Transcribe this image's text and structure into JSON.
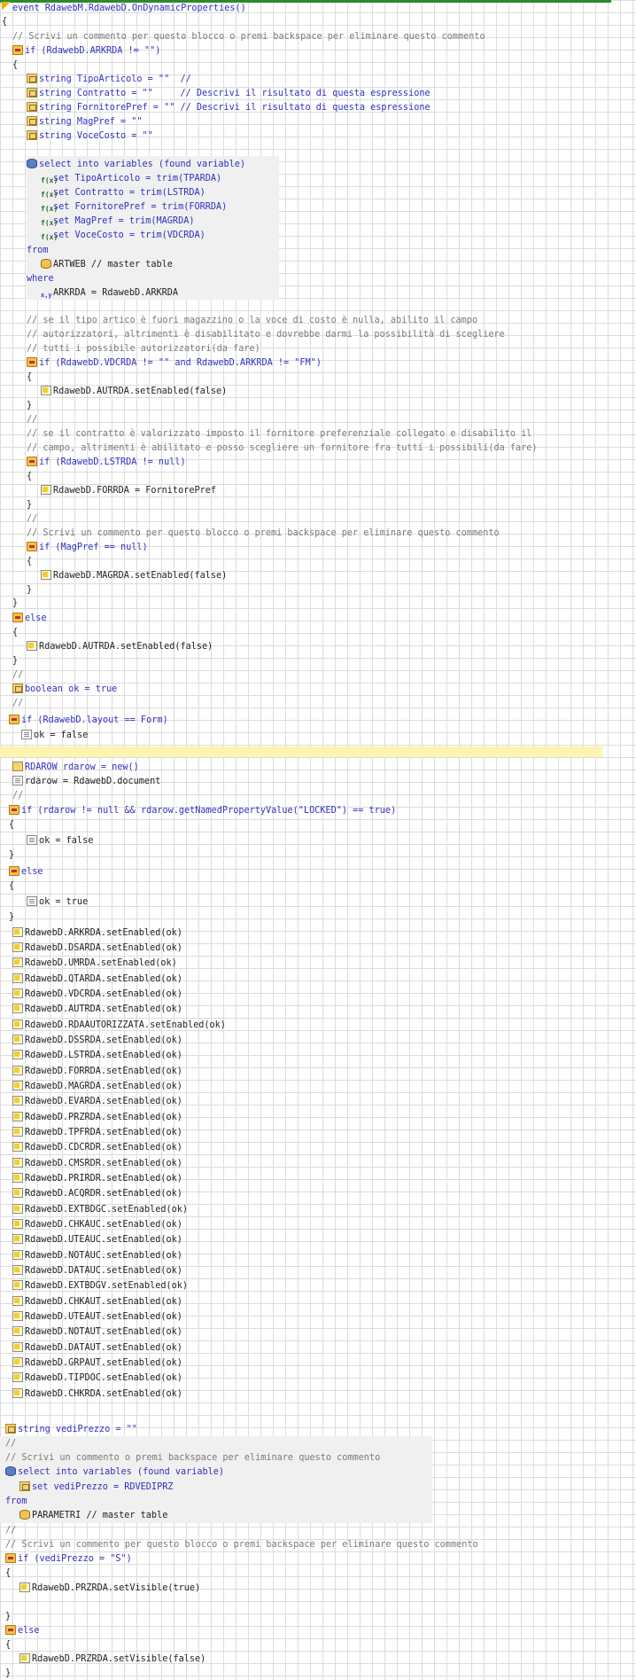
{
  "lines": [
    {
      "t": "event RdawebM.RdawebD.OnDynamicProperties()",
      "c": "kw",
      "icon": "event-icon"
    },
    {
      "t": "{",
      "c": ""
    },
    {
      "t": "// Scrivi un commento per questo blocco o premi backspace per eliminare questo commento",
      "c": "cm"
    },
    {
      "t": "if (RdawebD.ARKRDA != \"\")",
      "c": "kw",
      "icon": "if-icon",
      "i2": "record-icon"
    },
    {
      "t": "{",
      "c": ""
    },
    {
      "t": "string TipoArticolo = \"\"  //",
      "c": "kw",
      "icon": "variable-icon"
    },
    {
      "t": "string Contratto = \"\"     // Descrivi il risultato di questa espressione",
      "c": "kw",
      "icon": "variable-icon"
    },
    {
      "t": "string FornitorePref = \"\" // Descrivi il risultato di questa espressione",
      "c": "kw",
      "icon": "variable-icon"
    },
    {
      "t": "string MagPref = \"\"",
      "c": "kw",
      "icon": "variable-icon"
    },
    {
      "t": "string VoceCosto = \"\"",
      "c": "kw",
      "icon": "variable-icon"
    },
    {
      "t": "select into variables (found variable)",
      "c": "kw",
      "icon": "database-icon"
    },
    {
      "t": "set TipoArticolo = trim(TPARDA)",
      "c": "kw",
      "icon": "function-icon"
    },
    {
      "t": "set Contratto = trim(LSTRDA)",
      "c": "kw",
      "icon": "function-icon"
    },
    {
      "t": "set FornitorePref = trim(FORRDA)",
      "c": "kw",
      "icon": "function-icon"
    },
    {
      "t": "set MagPref = trim(MAGRDA)",
      "c": "kw",
      "icon": "function-icon"
    },
    {
      "t": "set VoceCosto = trim(VDCRDA)",
      "c": "kw",
      "icon": "function-icon"
    },
    {
      "t": "from",
      "c": "kw"
    },
    {
      "t": "ARTWEB // master table",
      "c": "",
      "icon": "table-icon"
    },
    {
      "t": "where",
      "c": "kw"
    },
    {
      "t": "ARKRDA = RdawebD.ARKRDA",
      "c": "",
      "icon": "xy-icon"
    },
    {
      "t": "// se il tipo artico è fuori magazzino o la voce di costo è nulla, abilito il campo",
      "c": "cm"
    },
    {
      "t": "// autorizzatori, altrimenti è disabilitato e dovrebbe darmi la possibilità di scegliere",
      "c": "cm"
    },
    {
      "t": "// tutti i possibile autorizzatori(da fare)",
      "c": "cm"
    },
    {
      "t": "if (RdawebD.VDCRDA != \"\" and RdawebD.ARKRDA != \"FM\")",
      "c": "kw",
      "icon": "if-icon"
    },
    {
      "t": "{",
      "c": ""
    },
    {
      "t": "RdawebD.AUTRDA.setEnabled(false)",
      "c": "",
      "icon": "field-icon"
    },
    {
      "t": "}",
      "c": ""
    },
    {
      "t": "//",
      "c": "cm"
    },
    {
      "t": "// se il contratto è valorizzato imposto il fornitore preferenziale collegato e disabilito il",
      "c": "cm"
    },
    {
      "t": "// campo, altrimenti è abilitato e posso scegliere un fornitore fra tutti i possibili(da fare)",
      "c": "cm"
    },
    {
      "t": "if (RdawebD.LSTRDA != null)",
      "c": "kw",
      "icon": "if-icon"
    },
    {
      "t": "{",
      "c": ""
    },
    {
      "t": "RdawebD.FORRDA = FornitorePref",
      "c": "",
      "icon": "field-icon"
    },
    {
      "t": "}",
      "c": ""
    },
    {
      "t": "//",
      "c": "cm"
    },
    {
      "t": "// Scrivi un commento per questo blocco o premi backspace per eliminare questo commento",
      "c": "cm"
    },
    {
      "t": "if (MagPref == null)",
      "c": "kw",
      "icon": "if-icon"
    },
    {
      "t": "{",
      "c": ""
    },
    {
      "t": "RdawebD.MAGRDA.setEnabled(false)",
      "c": "",
      "icon": "field-icon"
    },
    {
      "t": "}",
      "c": ""
    },
    {
      "t": "}",
      "c": ""
    },
    {
      "t": "else",
      "c": "kw",
      "icon": "if-icon"
    },
    {
      "t": "{",
      "c": ""
    },
    {
      "t": "RdawebD.AUTRDA.setEnabled(false)",
      "c": "",
      "icon": "field-icon"
    },
    {
      "t": "}",
      "c": ""
    },
    {
      "t": "//",
      "c": "cm"
    },
    {
      "t": "boolean ok = true",
      "c": "kw",
      "icon": "variable-icon"
    },
    {
      "t": "//",
      "c": "cm"
    },
    {
      "t": "if (RdawebD.layout == Form)",
      "c": "kw",
      "icon": "if-icon"
    },
    {
      "t": "ok = false",
      "c": "",
      "icon": "doc-icon"
    },
    {
      "t": "RDAROW rdarow = new()",
      "c": "kw",
      "icon": "object-icon"
    },
    {
      "t": "rdarow = RdawebD.document",
      "c": "",
      "icon": "doc-icon"
    },
    {
      "t": "//",
      "c": "cm"
    },
    {
      "t": "if (rdarow != null && rdarow.getNamedPropertyValue(\"LOCKED\") == true)",
      "c": "kw",
      "icon": "if-icon"
    },
    {
      "t": "{",
      "c": ""
    },
    {
      "t": "ok = false",
      "c": "",
      "icon": "doc-icon"
    },
    {
      "t": "}",
      "c": ""
    },
    {
      "t": "else",
      "c": "kw",
      "icon": "if-icon"
    },
    {
      "t": "{",
      "c": ""
    },
    {
      "t": "ok = true",
      "c": "",
      "icon": "doc-icon"
    },
    {
      "t": "}",
      "c": ""
    },
    {
      "t": "RdawebD.ARKRDA.setEnabled(ok)",
      "c": "",
      "icon": "field-icon"
    },
    {
      "t": "RdawebD.DSARDA.setEnabled(ok)",
      "c": "",
      "icon": "field-icon"
    },
    {
      "t": "RdawebD.UMRDA.setEnabled(ok)",
      "c": "",
      "icon": "field-icon"
    },
    {
      "t": "RdawebD.QTARDA.setEnabled(ok)",
      "c": "",
      "icon": "field-icon"
    },
    {
      "t": "RdawebD.VDCRDA.setEnabled(ok)",
      "c": "",
      "icon": "field-icon"
    },
    {
      "t": "RdawebD.AUTRDA.setEnabled(ok)",
      "c": "",
      "icon": "field-icon"
    },
    {
      "t": "RdawebD.RDAAUTORIZZATA.setEnabled(ok)",
      "c": "",
      "icon": "field-icon"
    },
    {
      "t": "RdawebD.DSSRDA.setEnabled(ok)",
      "c": "",
      "icon": "field-icon"
    },
    {
      "t": "RdawebD.LSTRDA.setEnabled(ok)",
      "c": "",
      "icon": "field-icon"
    },
    {
      "t": "RdawebD.FORRDA.setEnabled(ok)",
      "c": "",
      "icon": "field-icon"
    },
    {
      "t": "RdawebD.MAGRDA.setEnabled(ok)",
      "c": "",
      "icon": "field-icon"
    },
    {
      "t": "RdawebD.EVARDA.setEnabled(ok)",
      "c": "",
      "icon": "field-icon"
    },
    {
      "t": "RdawebD.PRZRDA.setEnabled(ok)",
      "c": "",
      "icon": "field-icon"
    },
    {
      "t": "RdawebD.TPFRDA.setEnabled(ok)",
      "c": "",
      "icon": "field-icon"
    },
    {
      "t": "RdawebD.CDCRDR.setEnabled(ok)",
      "c": "",
      "icon": "field-icon"
    },
    {
      "t": "RdawebD.CMSRDR.setEnabled(ok)",
      "c": "",
      "icon": "field-icon"
    },
    {
      "t": "RdawebD.PRIRDR.setEnabled(ok)",
      "c": "",
      "icon": "field-icon"
    },
    {
      "t": "RdawebD.ACQRDR.setEnabled(ok)",
      "c": "",
      "icon": "field-icon"
    },
    {
      "t": "RdawebD.EXTBDGC.setEnabled(ok)",
      "c": "",
      "icon": "field-icon"
    },
    {
      "t": "RdawebD.CHKAUC.setEnabled(ok)",
      "c": "",
      "icon": "field-icon"
    },
    {
      "t": "RdawebD.UTEAUC.setEnabled(ok)",
      "c": "",
      "icon": "field-icon"
    },
    {
      "t": "RdawebD.NOTAUC.setEnabled(ok)",
      "c": "",
      "icon": "field-icon"
    },
    {
      "t": "RdawebD.DATAUC.setEnabled(ok)",
      "c": "",
      "icon": "field-icon"
    },
    {
      "t": "RdawebD.EXTBDGV.setEnabled(ok)",
      "c": "",
      "icon": "field-icon"
    },
    {
      "t": "RdawebD.CHKAUT.setEnabled(ok)",
      "c": "",
      "icon": "field-icon"
    },
    {
      "t": "RdawebD.UTEAUT.setEnabled(ok)",
      "c": "",
      "icon": "field-icon"
    },
    {
      "t": "RdawebD.NOTAUT.setEnabled(ok)",
      "c": "",
      "icon": "field-icon"
    },
    {
      "t": "RdawebD.DATAUT.setEnabled(ok)",
      "c": "",
      "icon": "field-icon"
    },
    {
      "t": "RdawebD.GRPAUT.setEnabled(ok)",
      "c": "",
      "icon": "field-icon"
    },
    {
      "t": "RdawebD.TIPDOC.setEnabled(ok)",
      "c": "",
      "icon": "field-icon"
    },
    {
      "t": "RdawebD.CHKRDA.setEnabled(ok)",
      "c": "",
      "icon": "field-icon"
    },
    {
      "t": "string vediPrezzo = \"\"",
      "c": "kw",
      "icon": "variable-icon"
    },
    {
      "t": "//",
      "c": "cm"
    },
    {
      "t": "// Scrivi un commento o premi backspace per eliminare questo commento",
      "c": "cm"
    },
    {
      "t": "select into variables (found variable)",
      "c": "kw",
      "icon": "database-icon"
    },
    {
      "t": "set vediPrezzo = RDVEDIPRZ",
      "c": "kw",
      "icon": "variable-icon"
    },
    {
      "t": "from",
      "c": "kw"
    },
    {
      "t": "PARAMETRI // master table",
      "c": "",
      "icon": "table-icon"
    },
    {
      "t": "//",
      "c": "cm"
    },
    {
      "t": "// Scrivi un commento per questo blocco o premi backspace per eliminare questo commento",
      "c": "cm"
    },
    {
      "t": "if (vediPrezzo = \"S\")",
      "c": "kw",
      "icon": "if-icon"
    },
    {
      "t": "{",
      "c": ""
    },
    {
      "t": "RdawebD.PRZRDA.setVisible(true)",
      "c": "",
      "icon": "field-icon"
    },
    {
      "t": "}",
      "c": ""
    },
    {
      "t": "else",
      "c": "kw",
      "icon": "if-icon"
    },
    {
      "t": "{",
      "c": ""
    },
    {
      "t": "RdawebD.PRZRDA.setVisible(false)",
      "c": "",
      "icon": "field-icon"
    },
    {
      "t": "}",
      "c": ""
    }
  ]
}
